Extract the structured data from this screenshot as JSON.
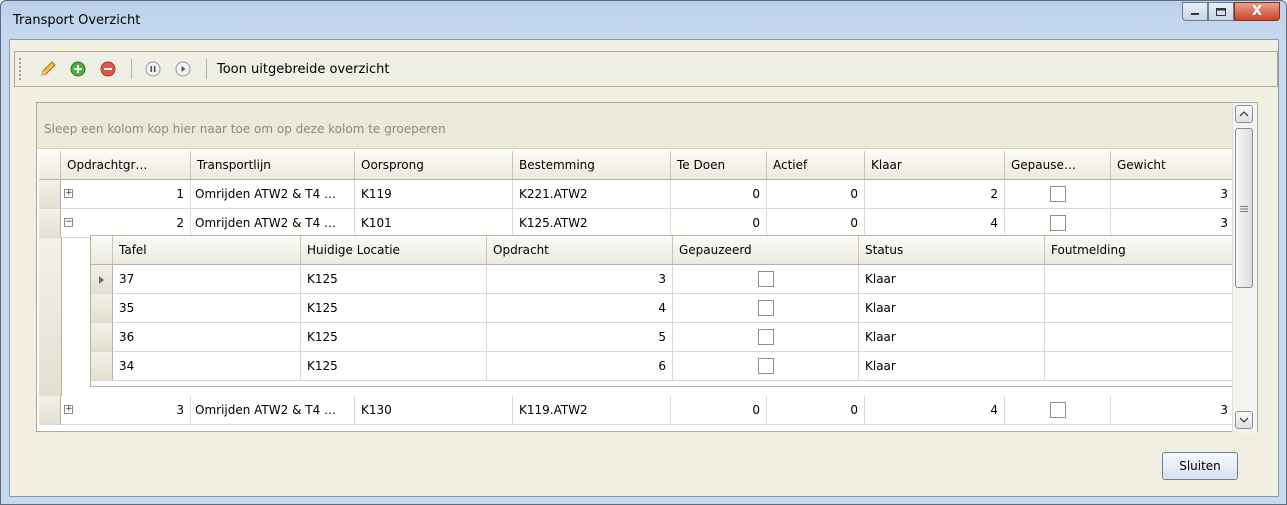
{
  "window": {
    "title": "Transport Overzicht",
    "close_glyph": "X"
  },
  "toolbar": {
    "icons": [
      "edit-pencil-icon",
      "add-green-icon",
      "remove-red-icon",
      "pause-icon",
      "play-icon"
    ],
    "label": "Toon uitgebreide overzicht"
  },
  "grid": {
    "group_hint": "Sleep een kolom kop hier naar toe om op deze kolom te groeperen",
    "columns": [
      "Opdrachtgr…",
      "Transportlijn",
      "Oorsprong",
      "Bestemming",
      "Te Doen",
      "Actief",
      "Klaar",
      "Gepause…",
      "Gewicht"
    ],
    "rows": [
      {
        "expander": "+",
        "opdrachtgroep": "1",
        "transportlijn": "Omrijden ATW2 & T4 …",
        "oorsprong": "K119",
        "bestemming": "K221.ATW2",
        "te_doen": "0",
        "actief": "0",
        "klaar": "2",
        "gepauzeerd": false,
        "gewicht": "3"
      },
      {
        "expander": "−",
        "opdrachtgroep": "2",
        "transportlijn": "Omrijden ATW2 & T4 …",
        "oorsprong": "K101",
        "bestemming": "K125.ATW2",
        "te_doen": "0",
        "actief": "0",
        "klaar": "4",
        "gepauzeerd": false,
        "gewicht": "3"
      },
      {
        "expander": "+",
        "opdrachtgroep": "3",
        "transportlijn": "Omrijden ATW2 & T4 …",
        "oorsprong": "K130",
        "bestemming": "K119.ATW2",
        "te_doen": "0",
        "actief": "0",
        "klaar": "4",
        "gepauzeerd": false,
        "gewicht": "3"
      }
    ],
    "detail": {
      "columns": [
        "Tafel",
        "Huidige Locatie",
        "Opdracht",
        "Gepauzeerd",
        "Status",
        "Foutmelding"
      ],
      "rows": [
        {
          "tafel": "37",
          "locatie": "K125",
          "opdracht": "3",
          "gepauzeerd": false,
          "status": "Klaar",
          "foutmelding": ""
        },
        {
          "tafel": "35",
          "locatie": "K125",
          "opdracht": "4",
          "gepauzeerd": false,
          "status": "Klaar",
          "foutmelding": ""
        },
        {
          "tafel": "36",
          "locatie": "K125",
          "opdracht": "5",
          "gepauzeerd": false,
          "status": "Klaar",
          "foutmelding": ""
        },
        {
          "tafel": "34",
          "locatie": "K125",
          "opdracht": "6",
          "gepauzeerd": false,
          "status": "Klaar",
          "foutmelding": ""
        }
      ]
    }
  },
  "footer": {
    "close_label": "Sluiten"
  }
}
